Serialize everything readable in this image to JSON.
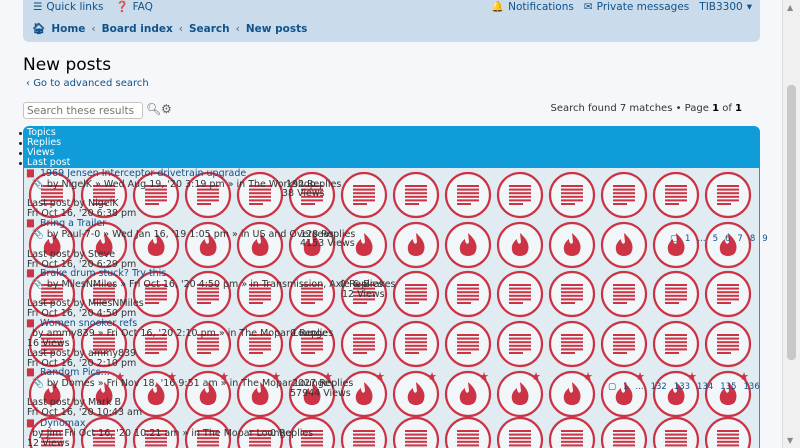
{
  "nav": {
    "quick_links": "Quick links",
    "faq": "FAQ",
    "notifications": "Notifications",
    "private_messages": "Private messages",
    "username": "TIB3300"
  },
  "breadcrumbs": [
    "Home",
    "Board index",
    "Search",
    "New posts"
  ],
  "page": {
    "title": "New posts",
    "advanced_search": "Go to advanced search",
    "search_placeholder": "Search these results",
    "found_prefix": "Search found 7 matches • Page ",
    "page_current": "1",
    "page_of": " of ",
    "page_total": "1"
  },
  "list_header": [
    "Topics",
    "Replies",
    "Views",
    "Last post"
  ],
  "topics": [
    {
      "title": "1969 Jensen Interceptor drivetrain upgrade",
      "meta": "by NigelK » Wed Aug 19, '20 3:19 pm » in The Workshop",
      "replies": "192 Replies",
      "views": "38 Views",
      "last_by": "Last post by NigelK",
      "last_time": "Fri Oct 16, '20 6:38 pm"
    },
    {
      "title": "Bring a Trailer",
      "meta": "by Paul-7-0 » Wed Jan 16, '19 1:05 pm » in US and Overseas",
      "replies": "128 Replies",
      "views": "4153 Views",
      "last_by": "Last post by Steve",
      "last_time": "Fri Oct 16, '20 6:29 pm",
      "pages": [
        "1",
        "...",
        "5",
        "6",
        "7",
        "8",
        "9"
      ]
    },
    {
      "title": "Brake drum stuck? Try this.",
      "meta": "by MilesNMiles » Fri Oct 16, '20 4:50 pm » in Transmission, Axle & Brakes",
      "replies": "0 Replies",
      "views": "12 Views",
      "last_by": "Last post by MilesNMiles",
      "last_time": "Fri Oct 16, '20 4:50 pm"
    },
    {
      "title": "Women snooker refs",
      "meta": "by ammy839 » Fri Oct 16, '20 2:10 pm » in The Mopar Lounge",
      "replies": "0 Replies",
      "views": "16 Views",
      "last_by": "Last post by ammy839",
      "last_time": "Fri Oct 16, '20 2:10 pm"
    },
    {
      "title": "Random Pics...",
      "meta": "by Domes » Fri Nov 18, '16 9:51 am » in The Mopar Lounge",
      "replies": "2027 Replies",
      "views": "57944 Views",
      "last_by": "Last post by Mark B",
      "last_time": "Fri Oct 16, '20 10:43 am",
      "pages": [
        "1",
        "...",
        "132",
        "133",
        "134",
        "135",
        "136"
      ]
    },
    {
      "title": "Dynomax",
      "meta": "by Jim Fri Oct 16, '20 10:21 am » in The Mopar Lounge",
      "replies": "0 Replies",
      "views": "12 Views"
    }
  ],
  "icons": {
    "circle_icon": "doc-lines-icon",
    "fire_icon": "hot-topic-fire-icon",
    "star_icon": "star-icon",
    "accent": "#cc3344"
  }
}
